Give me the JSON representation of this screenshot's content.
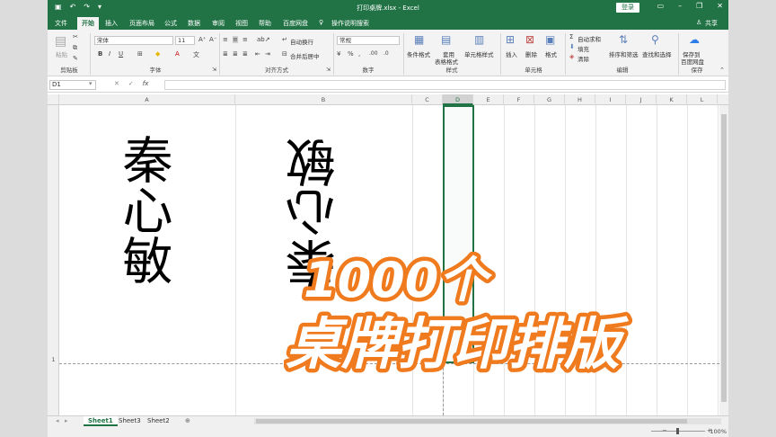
{
  "titlebar": {
    "document_title": "打印桌牌.xlsx - Excel",
    "login_label": "登录",
    "share_label": "共享"
  },
  "menu_tabs": [
    "文件",
    "开始",
    "插入",
    "页面布局",
    "公式",
    "数据",
    "审阅",
    "视图",
    "帮助",
    "百度网盘"
  ],
  "active_tab": "开始",
  "tell_me": "操作说明搜索",
  "ribbon": {
    "clipboard": {
      "paste": "粘贴",
      "group": "剪贴板"
    },
    "font": {
      "name": "宋体",
      "size": "11",
      "bold": "B",
      "italic": "I",
      "underline": "U",
      "group": "字体"
    },
    "alignment": {
      "wrap": "自动换行",
      "merge": "合并后居中",
      "group": "对齐方式"
    },
    "number": {
      "format": "常规",
      "group": "数字"
    },
    "styles": {
      "conditional": "条件格式",
      "table1": "套用",
      "table2": "表格格式",
      "cell_styles": "单元格样式",
      "group": "样式"
    },
    "cells": {
      "insert": "插入",
      "delete": "删除",
      "format": "格式",
      "group": "单元格"
    },
    "editing": {
      "autosum": "自动求和",
      "fill": "填充",
      "clear": "清除",
      "sort": "排序和筛选",
      "find": "查找和选择",
      "group": "编辑"
    },
    "save": {
      "label1": "保存到",
      "label2": "百度网盘",
      "group": "保存"
    }
  },
  "formula_bar": {
    "name_box": "D1",
    "fx": "fx",
    "value": ""
  },
  "columns": [
    "A",
    "B",
    "C",
    "D",
    "E",
    "F",
    "G",
    "H",
    "I",
    "J",
    "K",
    "L"
  ],
  "selected_column": "D",
  "row_label": "1",
  "cells": {
    "A1": "秦心敏",
    "B1": "秦心敏"
  },
  "sheets": [
    "Sheet1",
    "Sheet3",
    "Sheet2"
  ],
  "active_sheet": "Sheet1",
  "zoom": "100%",
  "overlay": {
    "line1": "1000个",
    "line2": "桌牌打印排版"
  },
  "colors": {
    "excel_green": "#217346",
    "overlay_orange": "#f07a1e"
  }
}
